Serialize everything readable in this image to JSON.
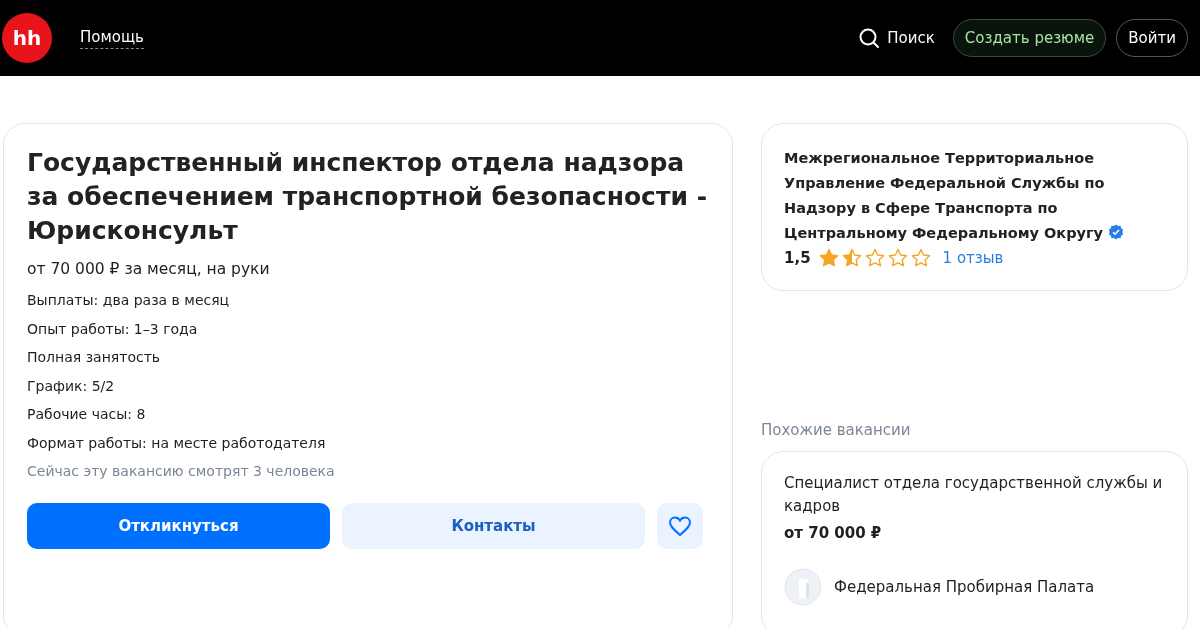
{
  "header": {
    "logo": "hh",
    "help_link": "Помощь",
    "search": "Поиск",
    "create_resume": "Создать резюме",
    "login": "Войти"
  },
  "vacancy": {
    "title": "Государственный инспектор отдела надзора за обеспечением транспортной безопасности - Юрисконсульт",
    "salary": "от 70 000 ₽ за месяц, на руки",
    "details": [
      "Выплаты: два раза в месяц",
      "Опыт работы: 1–3 года",
      "Полная занятость",
      "График: 5/2",
      "Рабочие часы: 8",
      "Формат работы: на месте работодателя"
    ],
    "viewers": "Сейчас эту вакансию смотрят 3 человека",
    "apply_button": "Откликнуться",
    "contacts_button": "Контакты",
    "favorite": false
  },
  "employer": {
    "name": "Межрегиональное Территориальное Управление Федеральной Службы по Надзору в Сфере Транспорта по Центральному Федеральному Округу",
    "verified": true,
    "rating": "1,5",
    "stars": 1.5,
    "reviews": "1 отзыв"
  },
  "similar": {
    "heading": "Похожие вакансии",
    "items": [
      {
        "title": "Специалист отдела государственной службы и кадров",
        "salary": "от 70 000 ₽",
        "company": "Федеральная Пробирная Палата"
      }
    ]
  }
}
